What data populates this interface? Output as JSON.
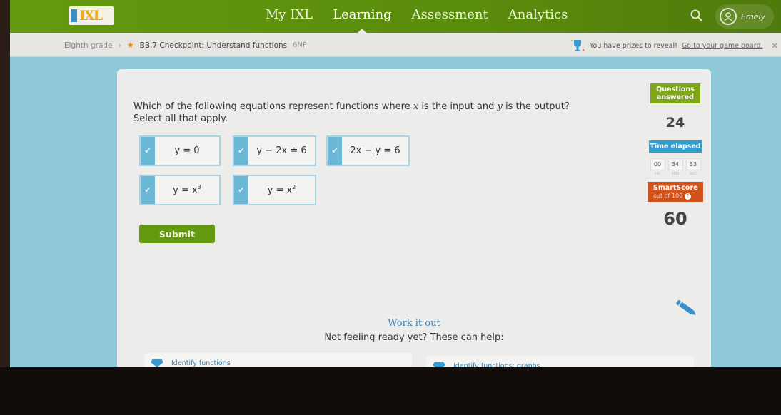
{
  "nav": {
    "logo": "IXL",
    "links": [
      "My IXL",
      "Learning",
      "Assessment",
      "Analytics"
    ],
    "active": "Learning",
    "user_name": "Emely"
  },
  "breadcrumb": {
    "grade": "Eighth grade",
    "separator": "›",
    "skill": "BB.7 Checkpoint: Understand functions",
    "code": "6NP"
  },
  "prize_banner": {
    "text": "You have prizes to reveal!",
    "link": "Go to your game board.",
    "close": "✕"
  },
  "question": {
    "prompt_parts": [
      "Which of the following equations represent functions where ",
      "x",
      " is the input and ",
      "y",
      " is the output?"
    ],
    "instruction": "Select all that apply.",
    "options": [
      {
        "label": "y = 0",
        "selected": false
      },
      {
        "label": "y − 2x ≐ 6",
        "selected": false
      },
      {
        "label": "2x − y = 6",
        "selected": false
      },
      {
        "label": "y = x",
        "sup": "3",
        "selected": false
      },
      {
        "label": "y = x",
        "sup": "2",
        "selected": false
      }
    ],
    "submit_label": "Submit"
  },
  "stats": {
    "questions_label": "Questions answered",
    "questions_value": "24",
    "time_label": "Time elapsed",
    "time": {
      "hr": "00",
      "min": "34",
      "sec": "53"
    },
    "time_units": {
      "hr": "HR",
      "min": "MIN",
      "sec": "SEC"
    },
    "smartscore_label": "SmartScore",
    "smartscore_sub": "out of 100",
    "smartscore_value": "60"
  },
  "work_it_out": {
    "title": "Work it out",
    "subtitle": "Not feeling ready yet? These can help:",
    "links": [
      "Identify functions",
      "Identify functions: graphs"
    ]
  },
  "colors": {
    "nav_green": "#5e8e0f",
    "accent_blue": "#6ab8d6",
    "smartscore_orange": "#d2521c",
    "time_blue": "#2f9fcf"
  }
}
